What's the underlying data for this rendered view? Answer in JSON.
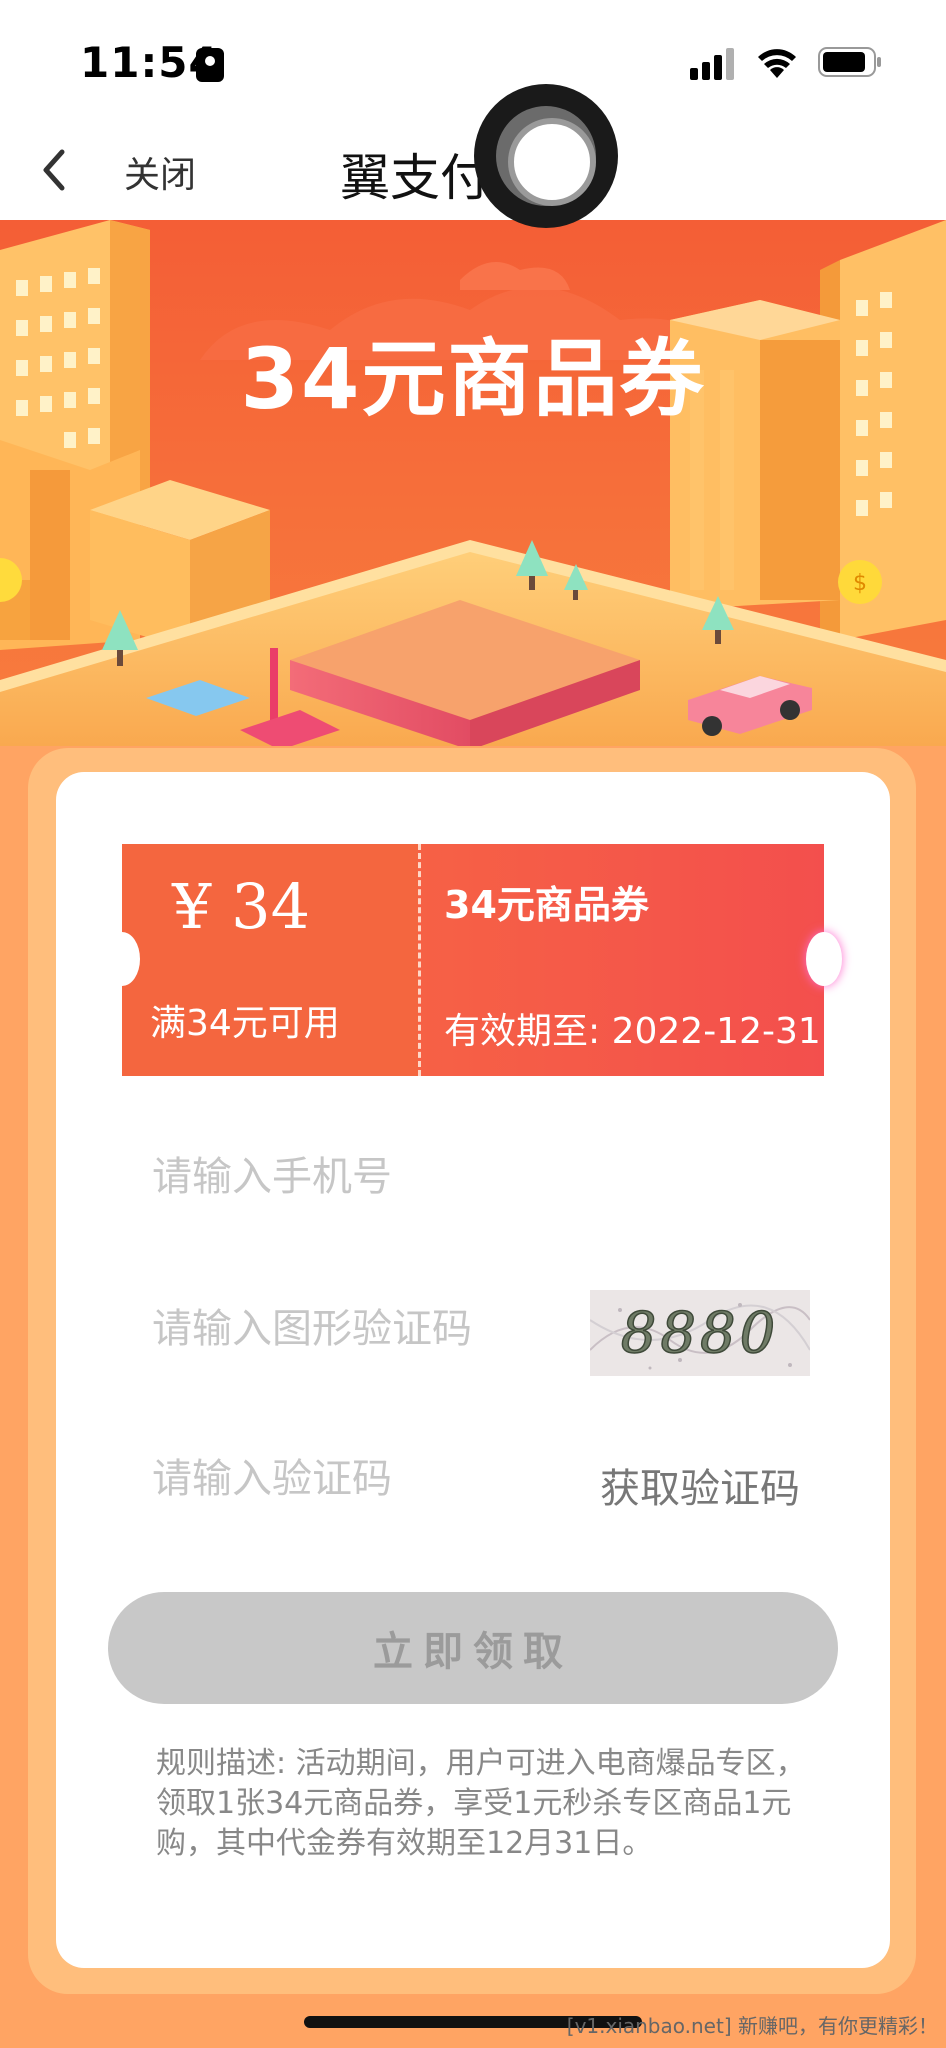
{
  "status_bar": {
    "time": "11:54",
    "icons": [
      "portrait-lock-icon",
      "signal-icon",
      "wifi-icon",
      "battery-icon"
    ]
  },
  "nav": {
    "close_label": "关闭",
    "title": "翼支付遇  礼"
  },
  "banner": {
    "title": "34元商品券"
  },
  "coupon": {
    "amount": "¥ 34",
    "condition": "满34元可用",
    "name": "34元商品券",
    "expiry": "有效期至: 2022-12-31"
  },
  "form": {
    "phone_placeholder": "请输入手机号",
    "captcha_placeholder": "请输入图形验证码",
    "captcha_text": "8880",
    "sms_placeholder": "请输入验证码",
    "get_code_label": "获取验证码",
    "claim_label": "立即领取"
  },
  "rules": {
    "text": "规则描述: 活动期间，用户可进入电商爆品专区，领取1张34元商品券，享受1元秒杀专区商品1元购，其中代金券有效期至12月31日。"
  },
  "watermark": "[v1.xianbao.net] 新赚吧，有你更精彩！",
  "colors": {
    "banner_bg": "#f56a3c",
    "page_bg": "#ffa463",
    "coupon": "#f4663f",
    "button_disabled": "#c8c8c8"
  }
}
